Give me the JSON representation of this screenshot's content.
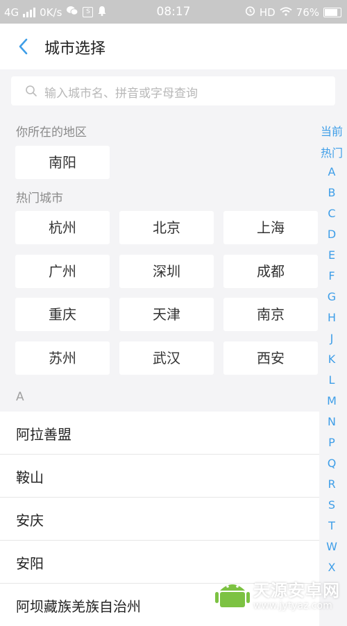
{
  "status_bar": {
    "network": "4G",
    "speed": "0K/s",
    "time": "08:17",
    "hd": "HD",
    "battery": "76%"
  },
  "header": {
    "title": "城市选择",
    "back_icon": "chevron-left-icon"
  },
  "search": {
    "placeholder": "输入城市名、拼音或字母查询",
    "icon": "search-icon"
  },
  "current_location": {
    "label": "你所在的地区",
    "city": "南阳"
  },
  "hot_cities": {
    "label": "热门城市",
    "items": [
      "杭州",
      "北京",
      "上海",
      "广州",
      "深圳",
      "成都",
      "重庆",
      "天津",
      "南京",
      "苏州",
      "武汉",
      "西安"
    ]
  },
  "letter_section": {
    "letter": "A",
    "items": [
      "阿拉善盟",
      "鞍山",
      "安庆",
      "安阳",
      "阿坝藏族羌族自治州"
    ]
  },
  "index_bar": [
    "当前",
    "热门",
    "A",
    "B",
    "C",
    "D",
    "E",
    "F",
    "G",
    "H",
    "J",
    "K",
    "L",
    "M",
    "N",
    "P",
    "Q",
    "R",
    "S",
    "T",
    "W",
    "X"
  ],
  "watermark": {
    "name": "天源安卓网",
    "url": "www.jytyaz.com"
  },
  "colors": {
    "accent": "#3e9ee8",
    "background": "#f4f4f6"
  }
}
